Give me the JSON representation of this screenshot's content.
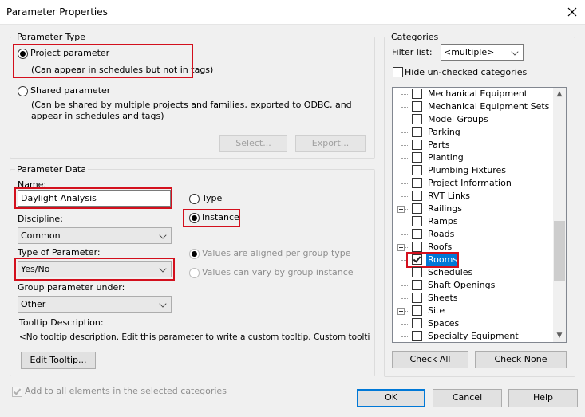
{
  "window": {
    "title": "Parameter Properties"
  },
  "parameter_type": {
    "group_title": "Parameter Type",
    "project_label": "Project parameter",
    "project_desc": "(Can appear in schedules but not in tags)",
    "shared_label": "Shared parameter",
    "shared_desc_line1": "(Can be shared by multiple projects and families, exported to ODBC, and",
    "shared_desc_line2": "appear in schedules and tags)",
    "select_button": "Select...",
    "export_button": "Export..."
  },
  "parameter_data": {
    "group_title": "Parameter Data",
    "name_label": "Name:",
    "name_value": "Daylight Analysis",
    "type_radio": "Type",
    "instance_radio": "Instance",
    "discipline_label": "Discipline:",
    "discipline_value": "Common",
    "type_of_parameter_label": "Type of Parameter:",
    "type_of_parameter_value": "Yes/No",
    "aligned_label": "Values are aligned per group type",
    "vary_label": "Values can vary by group instance",
    "group_under_label": "Group parameter under:",
    "group_under_value": "Other",
    "tooltip_label": "Tooltip Description:",
    "tooltip_value": "<No tooltip description. Edit this parameter to write a custom tooltip. Custom tooltips hav...",
    "edit_tooltip_button": "Edit Tooltip..."
  },
  "add_to_all": {
    "label": "Add to all elements in the selected categories",
    "checked": true
  },
  "categories": {
    "group_title": "Categories",
    "filter_label": "Filter list:",
    "filter_value": "<multiple>",
    "hide_unchecked_label": "Hide un-checked categories",
    "items": [
      {
        "label": "Mechanical Equipment",
        "expandable": false,
        "checked": false,
        "selected": false
      },
      {
        "label": "Mechanical Equipment Sets",
        "expandable": false,
        "checked": false,
        "selected": false
      },
      {
        "label": "Model Groups",
        "expandable": false,
        "checked": false,
        "selected": false
      },
      {
        "label": "Parking",
        "expandable": false,
        "checked": false,
        "selected": false
      },
      {
        "label": "Parts",
        "expandable": false,
        "checked": false,
        "selected": false
      },
      {
        "label": "Planting",
        "expandable": false,
        "checked": false,
        "selected": false
      },
      {
        "label": "Plumbing Fixtures",
        "expandable": false,
        "checked": false,
        "selected": false
      },
      {
        "label": "Project Information",
        "expandable": false,
        "checked": false,
        "selected": false
      },
      {
        "label": "RVT Links",
        "expandable": false,
        "checked": false,
        "selected": false
      },
      {
        "label": "Railings",
        "expandable": true,
        "checked": false,
        "selected": false
      },
      {
        "label": "Ramps",
        "expandable": false,
        "checked": false,
        "selected": false
      },
      {
        "label": "Roads",
        "expandable": false,
        "checked": false,
        "selected": false
      },
      {
        "label": "Roofs",
        "expandable": true,
        "checked": false,
        "selected": false
      },
      {
        "label": "Rooms",
        "expandable": false,
        "checked": true,
        "selected": true
      },
      {
        "label": "Schedules",
        "expandable": false,
        "checked": false,
        "selected": false
      },
      {
        "label": "Shaft Openings",
        "expandable": false,
        "checked": false,
        "selected": false
      },
      {
        "label": "Sheets",
        "expandable": false,
        "checked": false,
        "selected": false
      },
      {
        "label": "Site",
        "expandable": true,
        "checked": false,
        "selected": false
      },
      {
        "label": "Spaces",
        "expandable": false,
        "checked": false,
        "selected": false
      },
      {
        "label": "Specialty Equipment",
        "expandable": false,
        "checked": false,
        "selected": false
      }
    ],
    "check_all_button": "Check All",
    "check_none_button": "Check None"
  },
  "footer": {
    "ok": "OK",
    "cancel": "Cancel",
    "help": "Help"
  },
  "colors": {
    "highlight_red": "#d3101d",
    "selection_blue": "#0078d7"
  }
}
